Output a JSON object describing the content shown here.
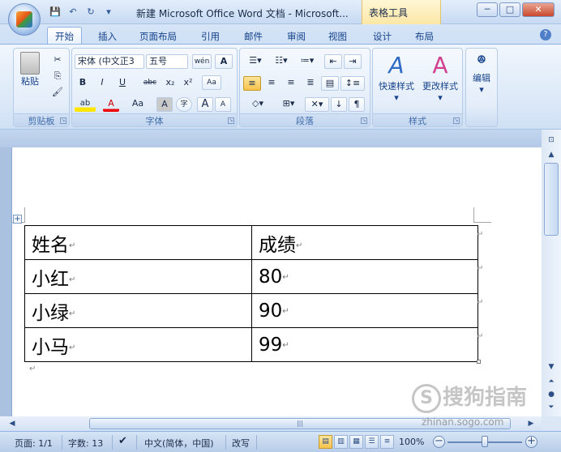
{
  "window": {
    "title": "新建 Microsoft Office Word 文档 - Microsoft...",
    "context_tab": "表格工具",
    "min": "─",
    "max": "□",
    "close": "✕"
  },
  "qat": {
    "save": "💾",
    "undo": "↶",
    "redo": "↻",
    "customize": "▾"
  },
  "tabs": [
    "开始",
    "插入",
    "页面布局",
    "引用",
    "邮件",
    "审阅",
    "视图",
    "设计",
    "布局"
  ],
  "ribbon": {
    "clipboard": {
      "label": "剪贴板",
      "paste": "粘贴",
      "cut": "✂",
      "copy": "⎘",
      "format_painter": "🖌"
    },
    "font": {
      "label": "字体",
      "font_name": "宋体 (中文正3",
      "font_size": "五号",
      "phonetic": "wén",
      "char_border": "A",
      "bold": "B",
      "italic": "I",
      "underline": "U",
      "strike": "abc",
      "sub": "x₂",
      "sup": "x²",
      "clear": "Aa",
      "highlight": "ab",
      "font_color": "A",
      "change_case": "Aa",
      "char_shading": "A",
      "enclose": "字",
      "grow": "A",
      "shrink": "A"
    },
    "paragraph": {
      "label": "段落"
    },
    "styles": {
      "label": "样式",
      "quick": "快速样式",
      "change": "更改样式"
    },
    "editing": {
      "label": "编辑",
      "find": "A"
    }
  },
  "table": {
    "rows": [
      [
        "姓名",
        "成绩"
      ],
      [
        "小红",
        "80"
      ],
      [
        "小绿",
        "90"
      ],
      [
        "小马",
        "99"
      ]
    ],
    "para_mark": "↵"
  },
  "status": {
    "page": "页面: 1/1",
    "words": "字数: 13",
    "language": "中文(简体，中国)",
    "mode": "改写",
    "zoom": "100%",
    "zoom_out": "−",
    "zoom_in": "+"
  },
  "watermark": {
    "brand": "搜狗指南",
    "logo": "S",
    "url": "zhinan.sogo.com"
  }
}
